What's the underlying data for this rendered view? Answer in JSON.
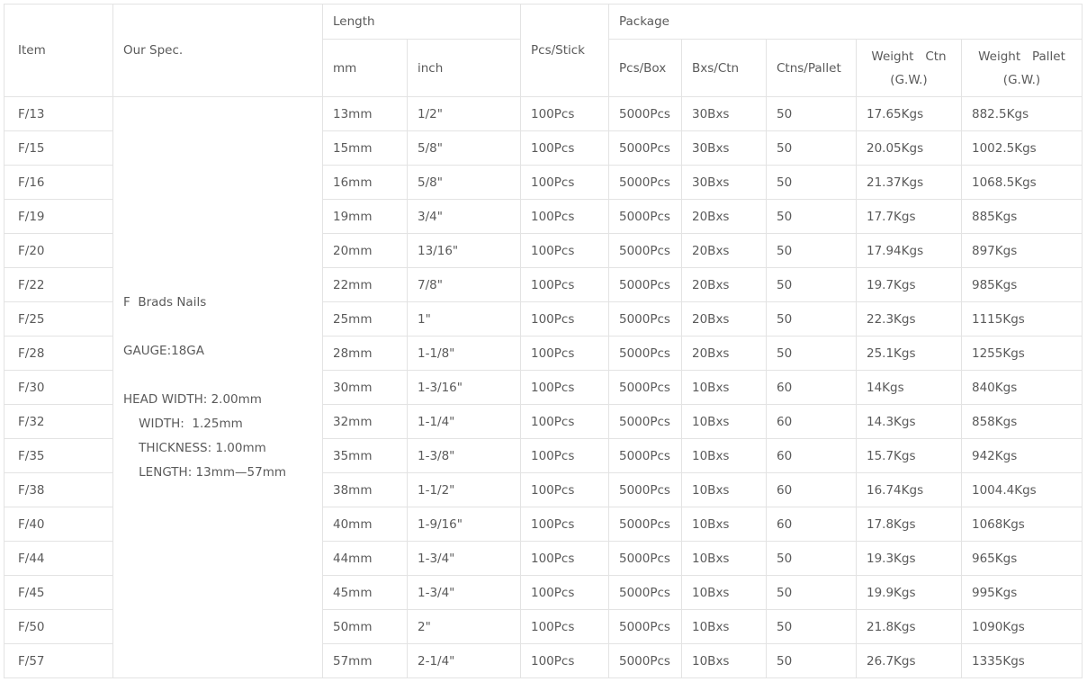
{
  "headers": {
    "item": "Item",
    "spec": "Our Spec.",
    "length": "Length",
    "mm": "mm",
    "inch": "inch",
    "pcs_stick": "Pcs/Stick",
    "package": "Package",
    "pcs_box": "Pcs/Box",
    "bxs_ctn": "Bxs/Ctn",
    "ctns_pallet": "Ctns/Pallet",
    "weight_ctn": "Weight   Ctn\n(G.W.)",
    "weight_pallet": "Weight   Pallet\n(G.W.)"
  },
  "spec_text": "F  Brads Nails\n\nGAUGE:18GA\n\nHEAD WIDTH: 2.00mm\n    WIDTH:  1.25mm\n    THICKNESS: 1.00mm\n    LENGTH: 13mm—57mm",
  "rows": [
    {
      "item": "F/13",
      "mm": "13mm",
      "inch": "1/2\"",
      "pcs": "100Pcs",
      "box": "5000Pcs",
      "ctn": "30Bxs",
      "pallet": "50",
      "wctn": "17.65Kgs",
      "wpallet": "882.5Kgs"
    },
    {
      "item": "F/15",
      "mm": "15mm",
      "inch": "5/8\"",
      "pcs": "100Pcs",
      "box": "5000Pcs",
      "ctn": "30Bxs",
      "pallet": "50",
      "wctn": "20.05Kgs",
      "wpallet": "1002.5Kgs"
    },
    {
      "item": "F/16",
      "mm": "16mm",
      "inch": "5/8\"",
      "pcs": "100Pcs",
      "box": "5000Pcs",
      "ctn": "30Bxs",
      "pallet": "50",
      "wctn": "21.37Kgs",
      "wpallet": "1068.5Kgs"
    },
    {
      "item": "F/19",
      "mm": "19mm",
      "inch": "3/4\"",
      "pcs": "100Pcs",
      "box": "5000Pcs",
      "ctn": "20Bxs",
      "pallet": "50",
      "wctn": "17.7Kgs",
      "wpallet": "885Kgs"
    },
    {
      "item": "F/20",
      "mm": "20mm",
      "inch": "13/16\"",
      "pcs": "100Pcs",
      "box": "5000Pcs",
      "ctn": "20Bxs",
      "pallet": "50",
      "wctn": "17.94Kgs",
      "wpallet": "897Kgs"
    },
    {
      "item": "F/22",
      "mm": "22mm",
      "inch": "7/8\"",
      "pcs": "100Pcs",
      "box": "5000Pcs",
      "ctn": "20Bxs",
      "pallet": "50",
      "wctn": "19.7Kgs",
      "wpallet": "985Kgs"
    },
    {
      "item": "F/25",
      "mm": "25mm",
      "inch": "1\"",
      "pcs": "100Pcs",
      "box": "5000Pcs",
      "ctn": "20Bxs",
      "pallet": "50",
      "wctn": "22.3Kgs",
      "wpallet": "1115Kgs"
    },
    {
      "item": "F/28",
      "mm": "28mm",
      "inch": "1-1/8\"",
      "pcs": "100Pcs",
      "box": "5000Pcs",
      "ctn": "20Bxs",
      "pallet": "50",
      "wctn": "25.1Kgs",
      "wpallet": "1255Kgs"
    },
    {
      "item": "F/30",
      "mm": "30mm",
      "inch": "1-3/16\"",
      "pcs": "100Pcs",
      "box": "5000Pcs",
      "ctn": "10Bxs",
      "pallet": "60",
      "wctn": "14Kgs",
      "wpallet": "840Kgs"
    },
    {
      "item": "F/32",
      "mm": "32mm",
      "inch": "1-1/4\"",
      "pcs": "100Pcs",
      "box": "5000Pcs",
      "ctn": "10Bxs",
      "pallet": "60",
      "wctn": "14.3Kgs",
      "wpallet": "858Kgs"
    },
    {
      "item": "F/35",
      "mm": "35mm",
      "inch": "1-3/8\"",
      "pcs": "100Pcs",
      "box": "5000Pcs",
      "ctn": "10Bxs",
      "pallet": "60",
      "wctn": "15.7Kgs",
      "wpallet": "942Kgs"
    },
    {
      "item": "F/38",
      "mm": "38mm",
      "inch": "1-1/2\"",
      "pcs": "100Pcs",
      "box": "5000Pcs",
      "ctn": "10Bxs",
      "pallet": "60",
      "wctn": "16.74Kgs",
      "wpallet": "1004.4Kgs"
    },
    {
      "item": "F/40",
      "mm": "40mm",
      "inch": "1-9/16\"",
      "pcs": "100Pcs",
      "box": "5000Pcs",
      "ctn": "10Bxs",
      "pallet": "60",
      "wctn": "17.8Kgs",
      "wpallet": "1068Kgs"
    },
    {
      "item": "F/44",
      "mm": "44mm",
      "inch": "1-3/4\"",
      "pcs": "100Pcs",
      "box": "5000Pcs",
      "ctn": "10Bxs",
      "pallet": "50",
      "wctn": "19.3Kgs",
      "wpallet": "965Kgs"
    },
    {
      "item": "F/45",
      "mm": "45mm",
      "inch": "1-3/4\"",
      "pcs": "100Pcs",
      "box": "5000Pcs",
      "ctn": "10Bxs",
      "pallet": "50",
      "wctn": "19.9Kgs",
      "wpallet": "995Kgs"
    },
    {
      "item": "F/50",
      "mm": "50mm",
      "inch": "2\"",
      "pcs": "100Pcs",
      "box": "5000Pcs",
      "ctn": "10Bxs",
      "pallet": "50",
      "wctn": "21.8Kgs",
      "wpallet": "1090Kgs"
    },
    {
      "item": "F/57",
      "mm": "57mm",
      "inch": "2-1/4\"",
      "pcs": "100Pcs",
      "box": "5000Pcs",
      "ctn": "10Bxs",
      "pallet": "50",
      "wctn": "26.7Kgs",
      "wpallet": "1335Kgs"
    }
  ]
}
